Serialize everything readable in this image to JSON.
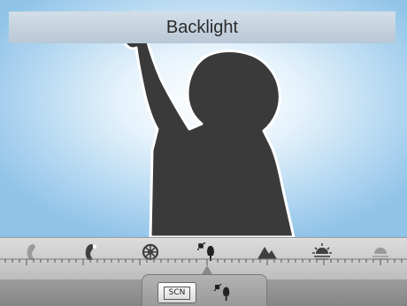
{
  "title": "Backlight",
  "scene_mode_button": {
    "label": "SCN",
    "icon": "scn-icon"
  },
  "current_mode_icon": "backlight-icon",
  "dial": {
    "options": [
      {
        "name": "portrait-icon"
      },
      {
        "name": "night-portrait-icon"
      },
      {
        "name": "party-icon"
      },
      {
        "name": "backlight-icon",
        "selected": true
      },
      {
        "name": "landscape-icon"
      },
      {
        "name": "sunrise-icon"
      },
      {
        "name": "sunset-icon"
      }
    ]
  },
  "colors": {
    "sky_center": "#ffffff",
    "sky_edge": "#9ccaea",
    "silhouette": "#3a3a3a",
    "title_bar": "#c6d3df"
  }
}
